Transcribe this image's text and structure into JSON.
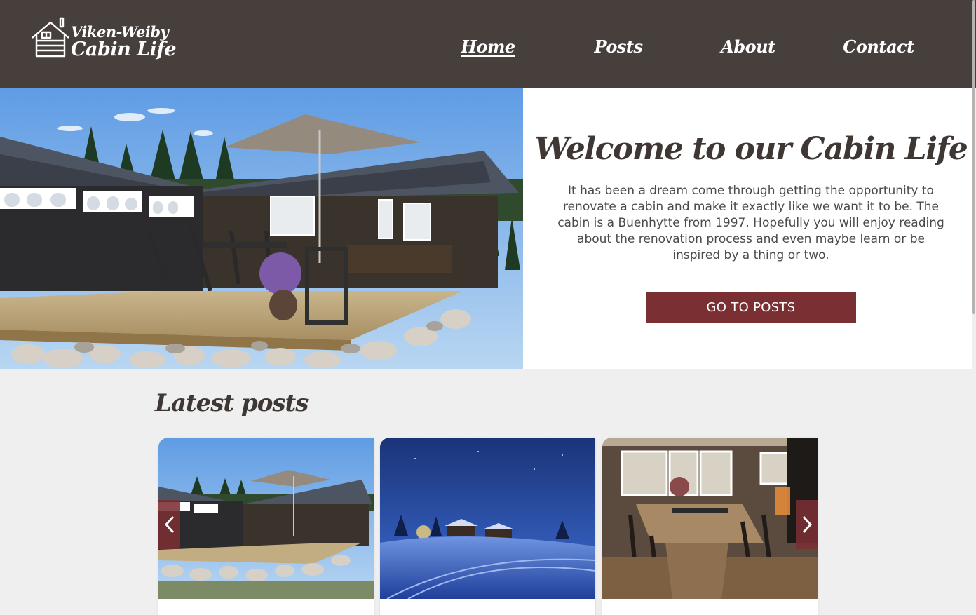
{
  "site": {
    "logo_line1": "Viken-Weiby",
    "logo_line2": "Cabin Life",
    "logo_icon": "cabin-icon"
  },
  "nav": {
    "items": [
      {
        "label": "Home",
        "active": true
      },
      {
        "label": "Posts",
        "active": false
      },
      {
        "label": "About",
        "active": false
      },
      {
        "label": "Contact",
        "active": false
      }
    ]
  },
  "hero": {
    "title": "Welcome to our Cabin Life",
    "text": "It has been a dream come through getting the opportunity to renovate a cabin and make it exactly like we want it to be. The cabin is a Buenhytte from 1997. Hopefully you will enjoy reading about the renovation process and even maybe learn or be inspired by a thing or two.",
    "cta_label": "GO TO POSTS",
    "image": "cabin-exterior-photo"
  },
  "latest": {
    "title": "Latest posts",
    "prev_icon": "chevron-left-icon",
    "next_icon": "chevron-right-icon",
    "cards": [
      {
        "image": "cabin-exterior-photo"
      },
      {
        "image": "winter-night-photo"
      },
      {
        "image": "dining-room-photo"
      }
    ]
  },
  "colors": {
    "header_bg": "#473f3c",
    "accent": "#7a2f33",
    "page_bg": "#efefef",
    "title_text": "#3e3734"
  }
}
